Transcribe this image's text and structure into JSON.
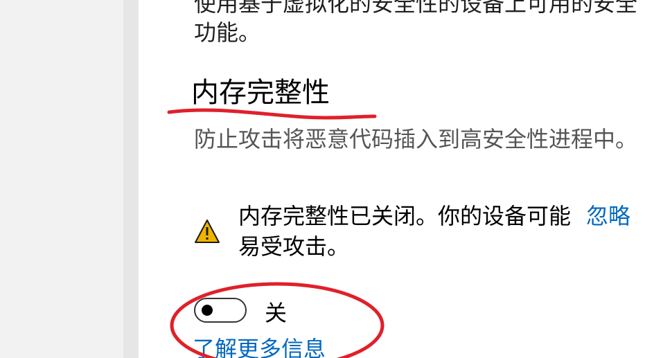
{
  "content": {
    "intro": "使用基于虚拟化的安全性的设备上可用的安全功能。",
    "memory_integrity": {
      "title": "内存完整性",
      "description": "防止攻击将恶意代码插入到高安全性进程中。",
      "warning": {
        "icon": "warning-icon",
        "text": "内存完整性已关闭。你的设备可能易受攻击。",
        "dismiss_label": "忽略"
      },
      "toggle": {
        "state_label": "关",
        "is_on": false
      },
      "learn_more_label": "了解更多信息"
    }
  },
  "colors": {
    "link": "#0067c0",
    "annotation": "#e0202a",
    "warning": "#f0b400"
  }
}
